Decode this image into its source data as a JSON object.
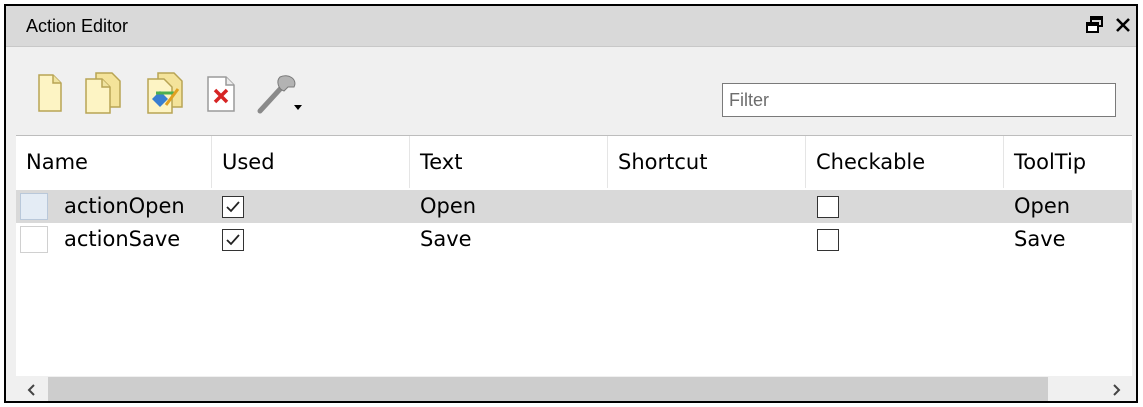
{
  "window": {
    "title": "Action Editor"
  },
  "icons": {
    "float": "float-icon",
    "close": "close-icon",
    "new": "new-action-icon",
    "copy": "copy-action-icon",
    "edit": "edit-action-icon",
    "delete": "delete-action-icon",
    "configure": "wrench-icon"
  },
  "filter": {
    "placeholder": "Filter",
    "value": ""
  },
  "table": {
    "columns": [
      "Name",
      "Used",
      "Text",
      "Shortcut",
      "Checkable",
      "ToolTip"
    ],
    "rows": [
      {
        "name": "actionOpen",
        "used": true,
        "text": "Open",
        "shortcut": "",
        "checkable": false,
        "tooltip": "Open",
        "selected": true
      },
      {
        "name": "actionSave",
        "used": true,
        "text": "Save",
        "shortcut": "",
        "checkable": false,
        "tooltip": "Save",
        "selected": false
      }
    ]
  },
  "colors": {
    "selected_row": "#d9d9d9",
    "titlebar": "#d9d9d9",
    "delete_x": "#d62424"
  }
}
